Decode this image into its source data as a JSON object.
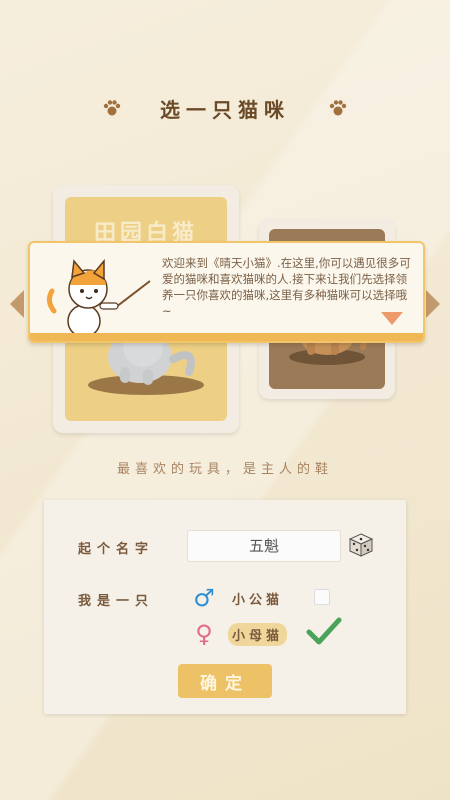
{
  "header": {
    "title": "选一只猫咪"
  },
  "cards": {
    "current_name": "田园白猫"
  },
  "dialog": {
    "message": "欢迎来到《晴天小猫》.在这里,你可以遇见很多可爱的猫咪和喜欢猫咪的人.接下来让我们先选择领养一只你喜欢的猫咪,这里有多种猫咪可以选择哦~"
  },
  "slogan": "最喜欢的玩具，是主人的鞋",
  "form": {
    "name_label": "起个名字",
    "name_value": "五魁",
    "gender_label": "我是一只",
    "male_label": "小公猫",
    "female_label": "小母猫",
    "selected_gender": "female",
    "confirm_label": "确定"
  },
  "colors": {
    "accent": "#edc267",
    "male": "#2f8fd2",
    "female": "#e26b8a",
    "check": "#4aa35a"
  }
}
